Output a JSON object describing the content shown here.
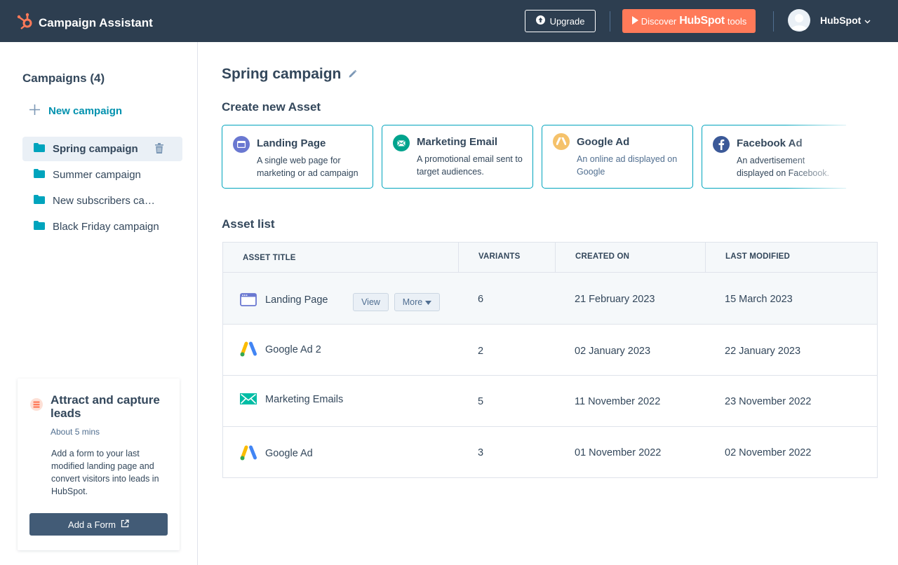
{
  "topbar": {
    "app_title": "Campaign Assistant",
    "upgrade_label": "Upgrade",
    "discover_prefix": "Discover",
    "discover_brand": "HubSpot",
    "discover_suffix": "tools",
    "account_name": "HubSpot",
    "colors": {
      "bar": "#2d3e50",
      "accent": "#ff7a59"
    }
  },
  "sidebar": {
    "title": "Campaigns (4)",
    "new_campaign_label": "New campaign",
    "campaigns": [
      {
        "label": "Spring campaign",
        "active": true
      },
      {
        "label": "Summer campaign",
        "active": false
      },
      {
        "label": "New subscribers campaign",
        "active": false
      },
      {
        "label": "Black Friday campaign",
        "active": false
      }
    ],
    "lead_card": {
      "title": "Attract and capture leads",
      "time": "About 5 mins",
      "description": "Add a form to your last modified landing page and convert visitors into leads in HubSpot.",
      "button_label": "Add a Form"
    }
  },
  "main": {
    "campaign_title": "Spring campaign",
    "create_asset_title": "Create new Asset",
    "asset_types": [
      {
        "icon": "landing-page-icon",
        "title": "Landing Page",
        "description": "A single web page for marketing or ad campaign"
      },
      {
        "icon": "email-icon",
        "title": "Marketing Email",
        "description": "A promotional email sent to target audiences."
      },
      {
        "icon": "google-ads-icon",
        "title": "Google Ad",
        "description": "An online ad displayed on Google"
      },
      {
        "icon": "facebook-icon",
        "title": "Facebook Ad",
        "description": "An advertisement displayed on Facebook."
      }
    ],
    "asset_list_title": "Asset list",
    "table": {
      "headers": {
        "title": "ASSET TITLE",
        "variants": "VARIANTS",
        "created": "CREATED ON",
        "modified": "LAST MODIFIED"
      },
      "view_label": "View",
      "more_label": "More",
      "rows": [
        {
          "icon": "landing-page-icon",
          "title": "Landing Page",
          "variants": "6",
          "created": "21 February 2023",
          "modified": "15 March 2023"
        },
        {
          "icon": "google-ads-icon",
          "title": "Google Ad 2",
          "variants": "2",
          "created": "02 January 2023",
          "modified": "22 January 2023"
        },
        {
          "icon": "email-icon",
          "title": "Marketing Emails",
          "variants": "5",
          "created": "11 November 2022",
          "modified": "23 November 2022"
        },
        {
          "icon": "google-ads-icon",
          "title": "Google Ad",
          "variants": "3",
          "created": "01 November 2022",
          "modified": "02 November 2022"
        }
      ]
    }
  }
}
